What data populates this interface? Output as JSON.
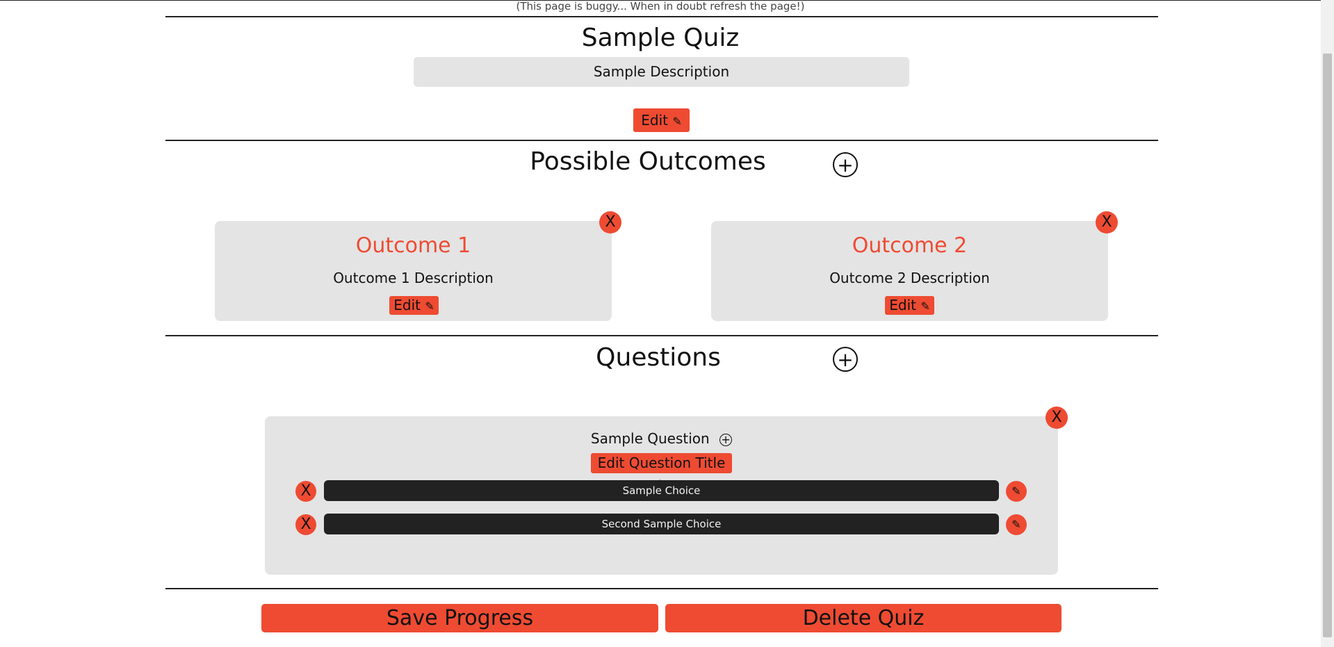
{
  "notice": "(This page is buggy... When in doubt refresh the page!)",
  "quiz": {
    "title": "Sample Quiz",
    "description": "Sample Description",
    "edit_label": "Edit"
  },
  "outcomes": {
    "heading": "Possible Outcomes",
    "items": [
      {
        "title": "Outcome 1",
        "description": "Outcome 1 Description",
        "edit_label": "Edit"
      },
      {
        "title": "Outcome 2",
        "description": "Outcome 2 Description",
        "edit_label": "Edit"
      }
    ]
  },
  "questions": {
    "heading": "Questions",
    "items": [
      {
        "title": "Sample Question",
        "edit_title_label": "Edit Question Title",
        "choices": [
          {
            "label": "Sample Choice"
          },
          {
            "label": "Second Sample Choice"
          }
        ]
      }
    ]
  },
  "icons": {
    "add": "+",
    "close": "X",
    "pencil": "✎"
  },
  "footer": {
    "save_label": "Save Progress",
    "delete_label": "Delete Quiz"
  },
  "colors": {
    "accent": "#ee4b32",
    "card_bg": "#e4e4e4",
    "choice_bg": "#222222"
  }
}
